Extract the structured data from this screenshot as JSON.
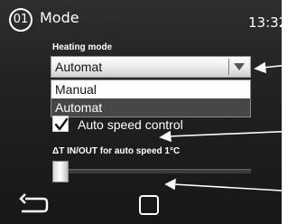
{
  "header": {
    "screen_number": "01",
    "title": "Mode",
    "time": "13:32"
  },
  "heating_mode": {
    "label": "Heating mode",
    "selected": "Automat",
    "options": [
      "Manual",
      "Automat"
    ],
    "highlighted_option": "Automat"
  },
  "auto_speed": {
    "label": "Auto speed control",
    "checked": true
  },
  "slider": {
    "label": "ΔT IN/OUT for auto speed  1°C",
    "value_fraction": 0.0
  },
  "bottom_nav": {
    "back_icon": "back-arrow-icon",
    "home_icon": "square-home-icon"
  },
  "colors": {
    "panel_bg": "#202020",
    "text": "#ffffff",
    "selected_row_bg": "#474747",
    "annotation": "#ffffff"
  }
}
